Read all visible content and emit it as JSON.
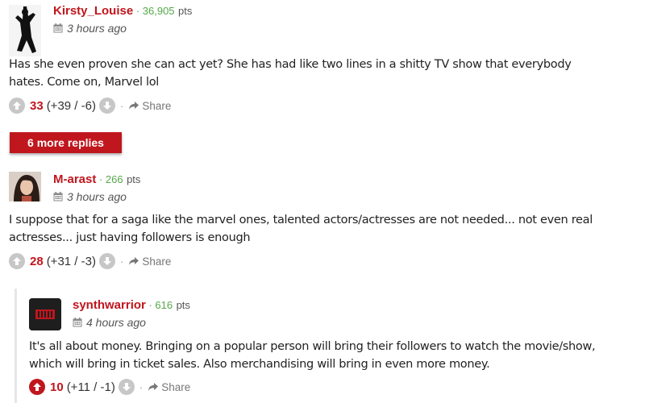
{
  "comments": [
    {
      "username": "Kirsty_Louise",
      "separator": " · ",
      "points": "36,905",
      "points_label": "pts",
      "time": "3 hours ago",
      "text": "Has she even proven she can act yet? She has had like two lines in a shitty TV show that everybody hates. Come on, Marvel lol",
      "score": "33",
      "detail": "(+39 / -6)",
      "share": "Share",
      "upvoted": false
    },
    {
      "username": "M-arast",
      "separator": " · ",
      "points": "266",
      "points_label": "pts",
      "time": "3 hours ago",
      "text": "I suppose that for a saga like the marvel ones, talented actors/actresses are not needed... not even real actresses... just having followers is enough",
      "score": "28",
      "detail": "(+31 / -3)",
      "share": "Share",
      "upvoted": false
    },
    {
      "username": "synthwarrior",
      "separator": " · ",
      "points": "616",
      "points_label": "pts",
      "time": "4 hours ago",
      "text": "It's all about money. Bringing on a popular person will bring their followers to watch the movie/show, which will bring in ticket sales. Also merchandising will bring in even more money.",
      "score": "10",
      "detail": "(+11 / -1)",
      "share": "Share",
      "upvoted": true
    }
  ],
  "more_replies_label": "6 more replies",
  "dot_separator": "·",
  "icons": {
    "upvote": "arrow-up-icon",
    "downvote": "arrow-down-icon",
    "share": "share-icon",
    "calendar": "calendar-icon"
  },
  "colors": {
    "accent": "#c0161d",
    "points": "#56a84a",
    "vote_inactive": "#c7c7c7"
  }
}
